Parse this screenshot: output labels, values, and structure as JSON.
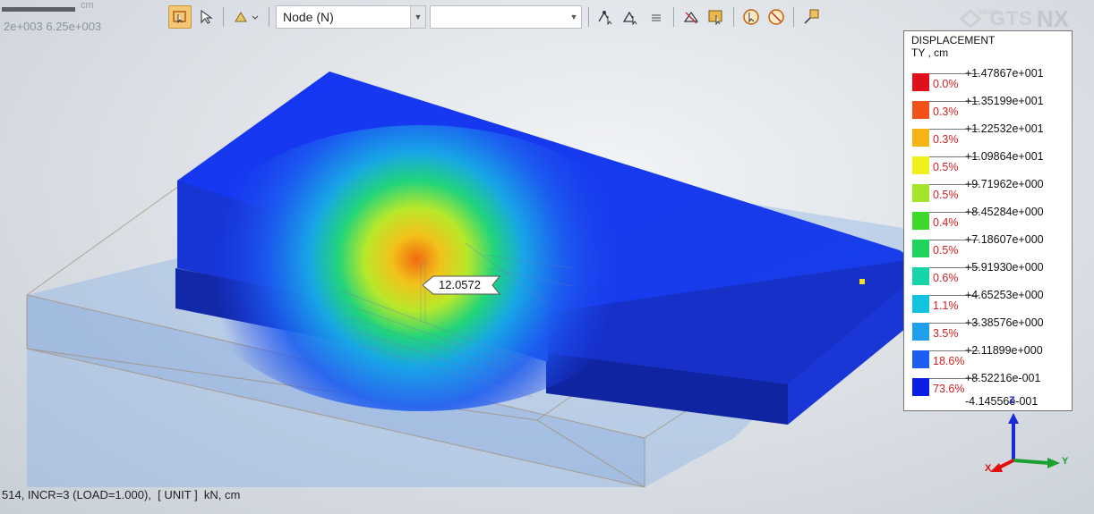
{
  "ruler": {
    "unit": "cm",
    "scale_text": "2e+003  6.25e+003"
  },
  "toolbar": {
    "selection_filter": "Node (N)",
    "second_select": ""
  },
  "logo": {
    "midas": "midas",
    "gts": "GTS",
    "nx": "NX"
  },
  "legend": {
    "title_line1": "DISPLACEMENT",
    "title_line2": "TY , cm",
    "rows": [
      {
        "value": "+1.47867e+001",
        "percent": "0.0%",
        "color": "#e0101a"
      },
      {
        "value": "+1.35199e+001",
        "percent": "0.3%",
        "color": "#f0521a"
      },
      {
        "value": "+1.22532e+001",
        "percent": "0.3%",
        "color": "#f5b316"
      },
      {
        "value": "+1.09864e+001",
        "percent": "0.5%",
        "color": "#f2f01c"
      },
      {
        "value": "+9.71962e+000",
        "percent": "0.5%",
        "color": "#a2e52a"
      },
      {
        "value": "+8.45284e+000",
        "percent": "0.4%",
        "color": "#3ed82a"
      },
      {
        "value": "+7.18607e+000",
        "percent": "0.5%",
        "color": "#1ed45e"
      },
      {
        "value": "+5.91930e+000",
        "percent": "0.6%",
        "color": "#14d4a8"
      },
      {
        "value": "+4.65253e+000",
        "percent": "1.1%",
        "color": "#10c4e0"
      },
      {
        "value": "+3.38576e+000",
        "percent": "3.5%",
        "color": "#20a0ec"
      },
      {
        "value": "+2.11899e+000",
        "percent": "18.6%",
        "color": "#1c5ef0"
      },
      {
        "value": "+8.52216e-001",
        "percent": "73.6%",
        "color": "#0a1ee6"
      }
    ],
    "min_value": "-4.14556e-001"
  },
  "probe_label": "12.0572",
  "status_text": "514, INCR=3 (LOAD=1.000),  [ UNIT ]  kN, cm",
  "axes": {
    "z": "Z",
    "x": "X",
    "y": "Y"
  },
  "colors": {
    "model_blue": "#1a3cf0",
    "dark_side": "#1128a8",
    "ground": "#7aa8e6"
  }
}
